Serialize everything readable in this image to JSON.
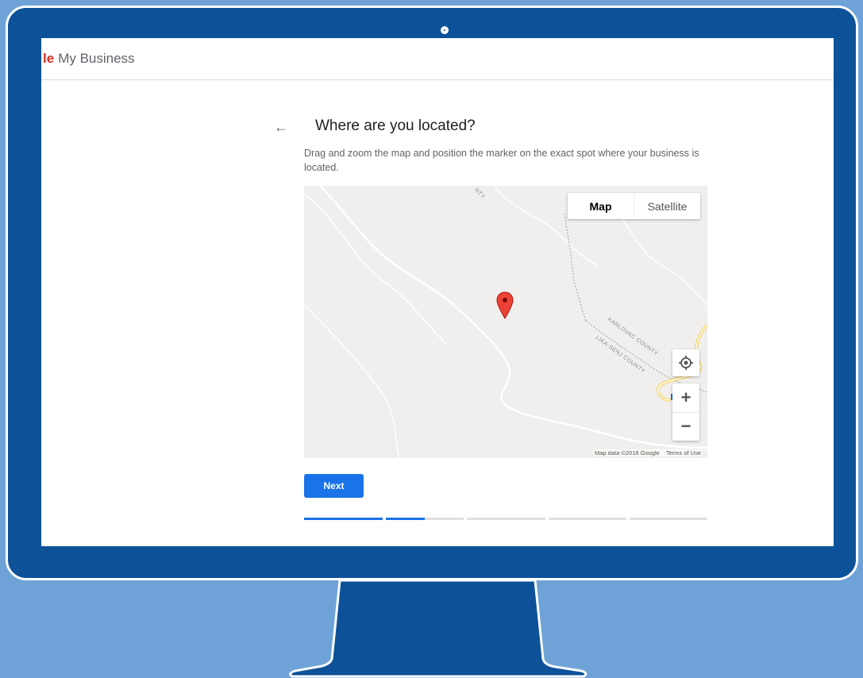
{
  "app": {
    "brand_logo_end": "le",
    "product_name": "My Business"
  },
  "page": {
    "back_label": "←",
    "title": "Where are you located?",
    "description": "Drag and zoom the map and position the marker on the exact spot where your business is located."
  },
  "map": {
    "type_options": [
      "Map",
      "Satellite"
    ],
    "selected_type": "Map",
    "county_labels": [
      "KARLOVAC COUNTY",
      "LIKA-SENJ COUNTY",
      "NTY"
    ],
    "attribution": "Map data ©2018 Google",
    "terms": "Terms of Use",
    "zoom_in": "+",
    "zoom_out": "−",
    "pin_color": "#ea4335"
  },
  "actions": {
    "next_label": "Next"
  },
  "progress": {
    "segments": [
      1,
      0.5,
      0,
      0,
      0
    ],
    "accent": "#1a73e8"
  },
  "colors": {
    "monitor": "#0d5299",
    "backdrop": "#6fa3d8",
    "accent": "#1a73e8"
  }
}
